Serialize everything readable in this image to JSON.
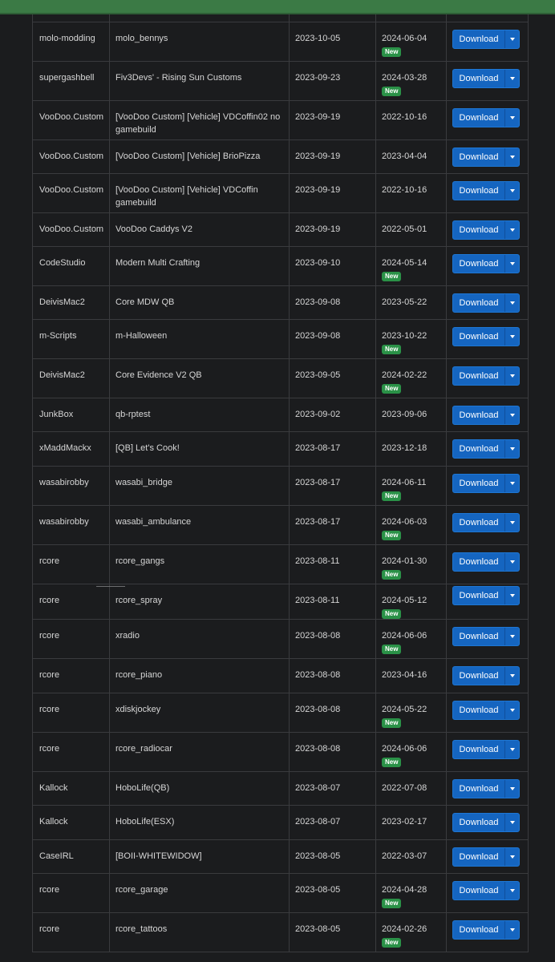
{
  "action_labels": {
    "download": "Download",
    "new_badge": "New"
  },
  "icons": {
    "caret": "chevron-down-icon"
  },
  "colors": {
    "primary_button": "#1565c0",
    "new_badge": "#2a9147",
    "top_bar": "#3b7a45"
  },
  "rows": [
    {
      "author": "molo-modding",
      "name": "molo_bennys",
      "created": "2023-10-05",
      "updated": "2024-06-04",
      "is_new": true
    },
    {
      "author": "supergashbell",
      "name": "Fiv3Devs' - Rising Sun Customs",
      "created": "2023-09-23",
      "updated": "2024-03-28",
      "is_new": true
    },
    {
      "author": "VooDoo.Custom",
      "name": "[VooDoo Custom] [Vehicle] VDCoffin02 no gamebuild",
      "created": "2023-09-19",
      "updated": "2022-10-16",
      "is_new": false
    },
    {
      "author": "VooDoo.Custom",
      "name": "[VooDoo Custom] [Vehicle] BrioPizza",
      "created": "2023-09-19",
      "updated": "2023-04-04",
      "is_new": false
    },
    {
      "author": "VooDoo.Custom",
      "name": "[VooDoo Custom] [Vehicle] VDCoffin gamebuild",
      "created": "2023-09-19",
      "updated": "2022-10-16",
      "is_new": false
    },
    {
      "author": "VooDoo.Custom",
      "name": "VooDoo Caddys V2",
      "created": "2023-09-19",
      "updated": "2022-05-01",
      "is_new": false
    },
    {
      "author": "CodeStudio",
      "name": "Modern Multi Crafting",
      "created": "2023-09-10",
      "updated": "2024-05-14",
      "is_new": true
    },
    {
      "author": "DeivisMac2",
      "name": "Core MDW QB",
      "created": "2023-09-08",
      "updated": "2023-05-22",
      "is_new": false
    },
    {
      "author": "m-Scripts",
      "name": "m-Halloween",
      "created": "2023-09-08",
      "updated": "2023-10-22",
      "is_new": true
    },
    {
      "author": "DeivisMac2",
      "name": "Core Evidence V2 QB",
      "created": "2023-09-05",
      "updated": "2024-02-22",
      "is_new": true
    },
    {
      "author": "JunkBox",
      "name": "qb-rptest",
      "created": "2023-09-02",
      "updated": "2023-09-06",
      "is_new": false
    },
    {
      "author": "xMaddMackx",
      "name": "[QB] Let's Cook!",
      "created": "2023-08-17",
      "updated": "2023-12-18",
      "is_new": false
    },
    {
      "author": "wasabirobby",
      "name": "wasabi_bridge",
      "created": "2023-08-17",
      "updated": "2024-06-11",
      "is_new": true
    },
    {
      "author": "wasabirobby",
      "name": "wasabi_ambulance",
      "created": "2023-08-17",
      "updated": "2024-06-03",
      "is_new": true
    },
    {
      "author": "rcore",
      "name": "rcore_gangs",
      "created": "2023-08-11",
      "updated": "2024-01-30",
      "is_new": true
    },
    {
      "author": "rcore",
      "name": "rcore_spray",
      "created": "2023-08-11",
      "updated": "2024-05-12",
      "is_new": true
    },
    {
      "author": "rcore",
      "name": "xradio",
      "created": "2023-08-08",
      "updated": "2024-06-06",
      "is_new": true
    },
    {
      "author": "rcore",
      "name": "rcore_piano",
      "created": "2023-08-08",
      "updated": "2023-04-16",
      "is_new": false
    },
    {
      "author": "rcore",
      "name": "xdiskjockey",
      "created": "2023-08-08",
      "updated": "2024-05-22",
      "is_new": true
    },
    {
      "author": "rcore",
      "name": "rcore_radiocar",
      "created": "2023-08-08",
      "updated": "2024-06-06",
      "is_new": true
    },
    {
      "author": "Kallock",
      "name": "HoboLife(QB)",
      "created": "2023-08-07",
      "updated": "2022-07-08",
      "is_new": false
    },
    {
      "author": "Kallock",
      "name": "HoboLife(ESX)",
      "created": "2023-08-07",
      "updated": "2023-02-17",
      "is_new": false
    },
    {
      "author": "CaseIRL",
      "name": "[BOII-WHITEWIDOW]",
      "created": "2023-08-05",
      "updated": "2022-03-07",
      "is_new": false
    },
    {
      "author": "rcore",
      "name": "rcore_garage",
      "created": "2023-08-05",
      "updated": "2024-04-28",
      "is_new": true
    },
    {
      "author": "rcore",
      "name": "rcore_tattoos",
      "created": "2023-08-05",
      "updated": "2024-02-26",
      "is_new": true
    }
  ]
}
